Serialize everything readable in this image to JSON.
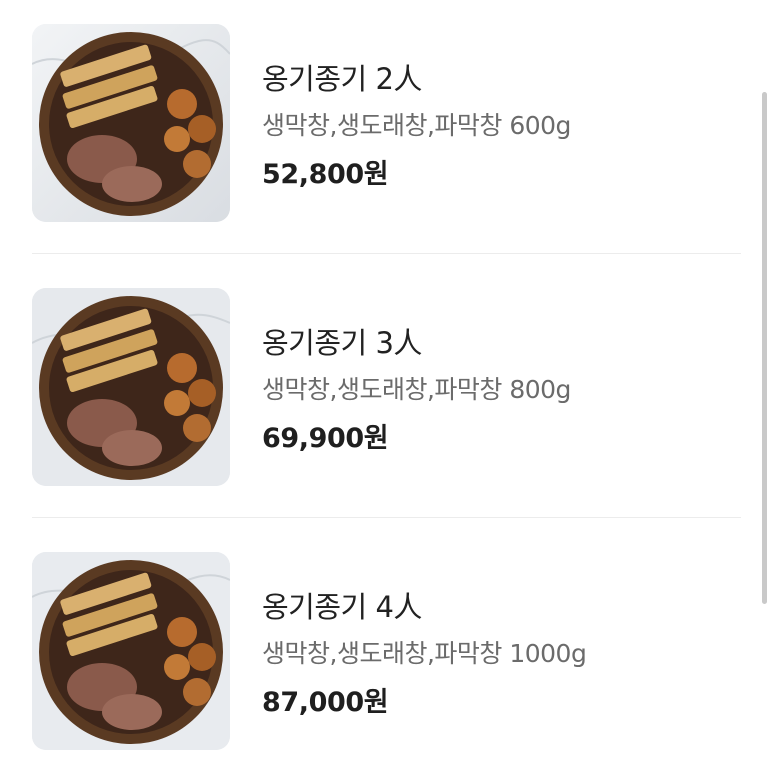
{
  "items": [
    {
      "title": "옹기종기 2人",
      "description": "생막창,생도래창,파막창 600g",
      "price": "52,800원",
      "image_icon": "food-image"
    },
    {
      "title": "옹기종기 3人",
      "description": "생막창,생도래창,파막창 800g",
      "price": "69,900원",
      "image_icon": "food-image"
    },
    {
      "title": "옹기종기 4人",
      "description": "생막창,생도래창,파막창 1000g",
      "price": "87,000원",
      "image_icon": "food-image"
    }
  ],
  "colors": {
    "title": "#222222",
    "description": "#6b6b6b",
    "price": "#1f1f1f",
    "divider": "#ececec",
    "scrollbar": "#c9c9c9"
  }
}
